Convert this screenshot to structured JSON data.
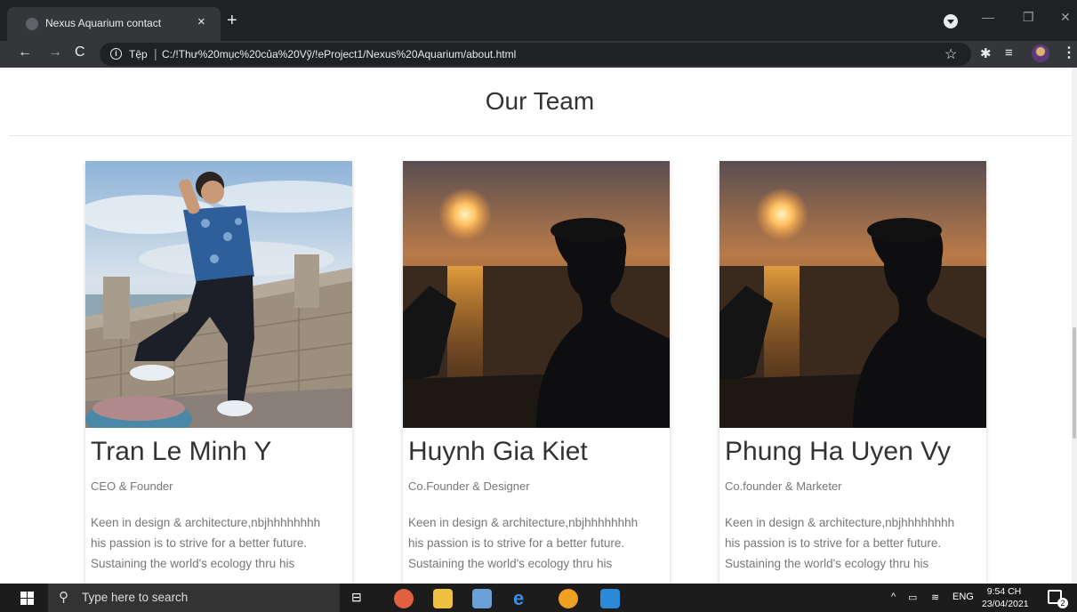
{
  "browser": {
    "tab_title": "Nexus Aquarium contact",
    "tab_close": "×",
    "new_tab": "+",
    "url_scheme": "Tệp",
    "url_sep": "|",
    "url": "C:/!Thư%20mục%20của%20Vỹ/!eProject1/Nexus%20Aquarium/about.html"
  },
  "page": {
    "heading": "Our Team",
    "team": [
      {
        "name": "Tran Le Minh Y",
        "role": "CEO & Founder",
        "bio": [
          "Keen in design & architecture,nbjhhhhhhhh",
          "his passion is to strive for a better future.",
          "Sustaining the world's ecology thru his"
        ]
      },
      {
        "name": "Huynh Gia Kiet",
        "role": "Co.Founder & Designer",
        "bio": [
          "Keen in design & architecture,nbjhhhhhhhh",
          "his passion is to strive for a better future.",
          "Sustaining the world's ecology thru his"
        ]
      },
      {
        "name": "Phung Ha Uyen Vy",
        "role": "Co.founder & Marketer",
        "bio": [
          "Keen in design & architecture,nbjhhhhhhhh",
          "his passion is to strive for a better future.",
          "Sustaining the world's ecology thru his"
        ]
      }
    ]
  },
  "taskbar": {
    "search_placeholder": "Type here to search",
    "language": "ENG",
    "time": "9:54 CH",
    "date": "23/04/2021",
    "notification_count": "2"
  }
}
